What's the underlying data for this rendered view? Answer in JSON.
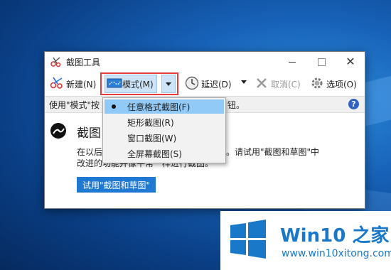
{
  "window": {
    "title": "截图工具",
    "controls": {
      "close": "✕"
    }
  },
  "toolbar": {
    "new_label": "新建(N)",
    "mode_label": "模式(M)",
    "delay_label": "延迟(D)",
    "cancel_label": "取消(C)",
    "options_label": "选项(O)"
  },
  "hint": {
    "left": "使用\"模式\"按",
    "right": "钮。",
    "help": "?"
  },
  "main": {
    "heading": "截图",
    "para1_left": "在以后",
    "para1_right": "。请试用\"截图和草图\"中",
    "para2": "改进的功能并像平常一样进行截图。",
    "try_button": "试用\"截图和草图\""
  },
  "menu": {
    "items": [
      {
        "label": "任意格式截图(F)",
        "selected": true
      },
      {
        "label": "矩形截图(R)",
        "selected": false
      },
      {
        "label": "窗口截图(W)",
        "selected": false
      },
      {
        "label": "全屏幕截图(S)",
        "selected": false
      }
    ]
  },
  "watermark": {
    "title": "Win10 之家",
    "url": "www.win10xitong.com"
  },
  "colors": {
    "highlight_border": "#e83a3a",
    "menu_selected": "#91c9f7",
    "button_blue": "#1f78d1",
    "brand_blue": "#1a78c8"
  }
}
